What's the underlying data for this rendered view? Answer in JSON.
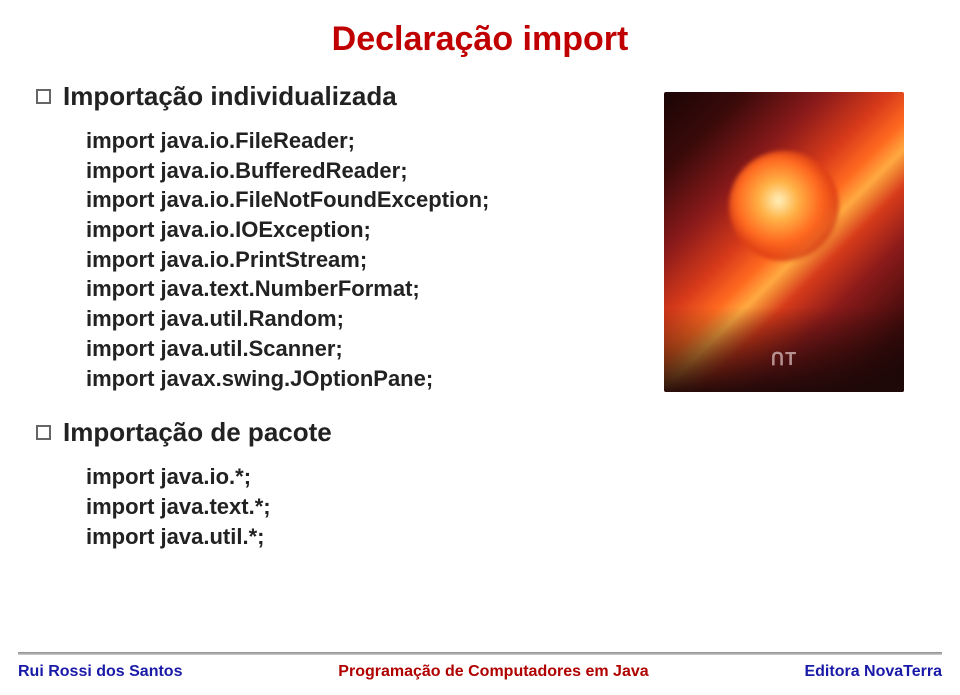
{
  "title": "Declaração import",
  "section1": {
    "heading": "Importação individualizada",
    "lines": [
      "import java.io.FileReader;",
      "import java.io.BufferedReader;",
      "import java.io.FileNotFoundException;",
      "import java.io.IOException;",
      "import java.io.PrintStream;",
      "import java.text.NumberFormat;",
      "import java.util.Random;",
      "import java.util.Scanner;",
      "import javax.swing.JOptionPane;"
    ]
  },
  "section2": {
    "heading": "Importação de pacote",
    "lines": [
      "import java.io.*;",
      "import java.text.*;",
      "import java.util.*;"
    ]
  },
  "deco_logo": "ᑎT",
  "footer": {
    "left": "Rui Rossi dos Santos",
    "center": "Programação de Computadores em Java",
    "right": "Editora NovaTerra"
  }
}
